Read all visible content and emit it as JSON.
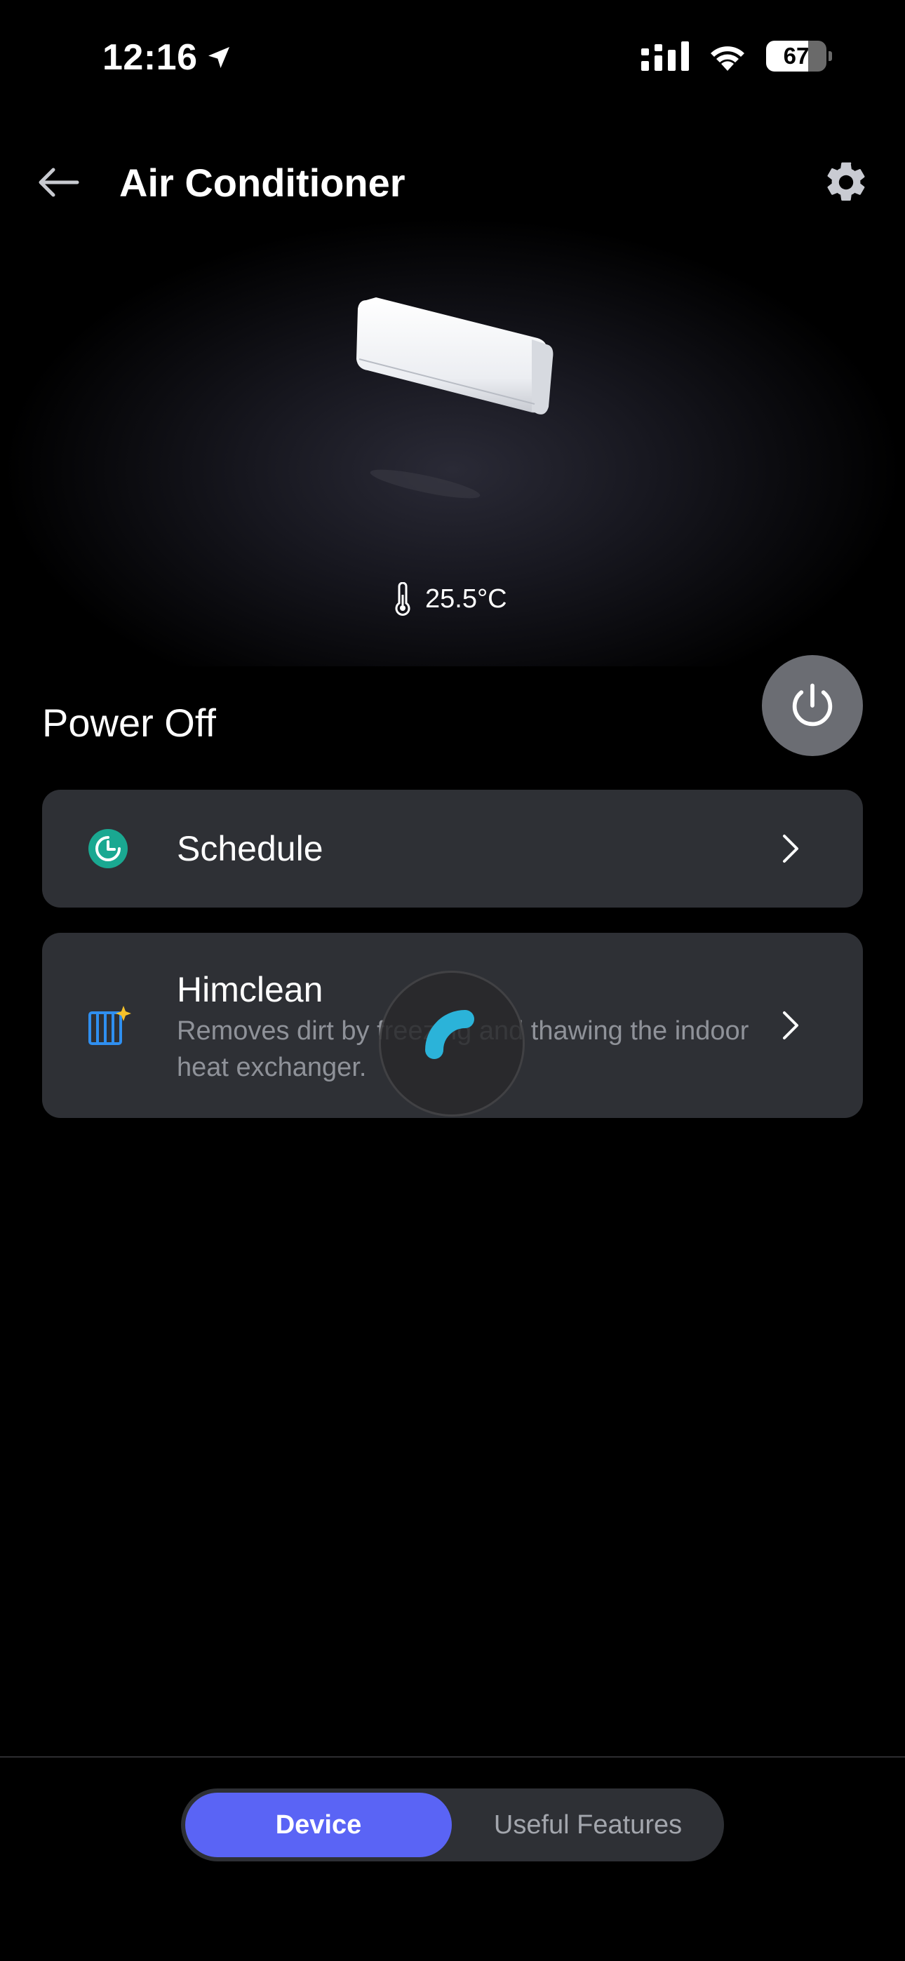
{
  "status_bar": {
    "time": "12:16",
    "battery": "67"
  },
  "header": {
    "title": "Air Conditioner"
  },
  "device": {
    "temperature": "25.5°C",
    "power_status": "Power Off"
  },
  "cards": [
    {
      "title": "Schedule"
    },
    {
      "title": "Himclean",
      "description": "Removes dirt by freezing and thawing the indoor heat exchanger."
    }
  ],
  "tabs": {
    "device": "Device",
    "useful_features": "Useful Features"
  },
  "colors": {
    "accent": "#5a64f5",
    "schedule_icon": "#1aa891",
    "himclean_icon": "#2f8ff0",
    "spinner": "#2bb3d9",
    "card_bg": "#2e3035"
  }
}
